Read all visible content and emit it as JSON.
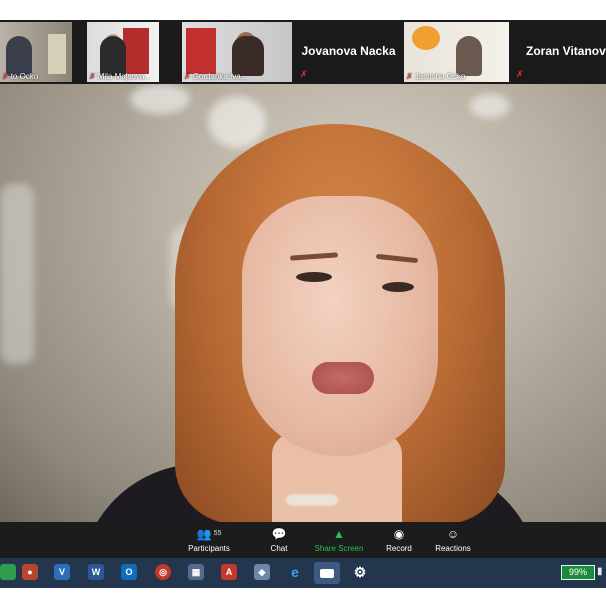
{
  "gallery": {
    "tiles": [
      {
        "name": "to Ocko"
      },
      {
        "name": "Mila Mojsova..."
      },
      {
        "name": "Gordanka Iva..."
      },
      {
        "name": "Jovanova Nacka"
      },
      {
        "name": "Jasmina Ocko"
      },
      {
        "name": "Zoran Vitanov"
      }
    ]
  },
  "main": {
    "speaker": "active speaker"
  },
  "toolbar": {
    "participants_label": "Participants",
    "participants_count": "55",
    "chat_label": "Chat",
    "share_label": "Share Screen",
    "record_label": "Record",
    "reactions_label": "Reactions"
  },
  "taskbar": {
    "battery": "99%"
  },
  "colors": {
    "share_green": "#23c552",
    "toolbar_bg": "#1c1c1c",
    "taskbar_bg": "#23364e",
    "mic_off_red": "#e03434"
  }
}
